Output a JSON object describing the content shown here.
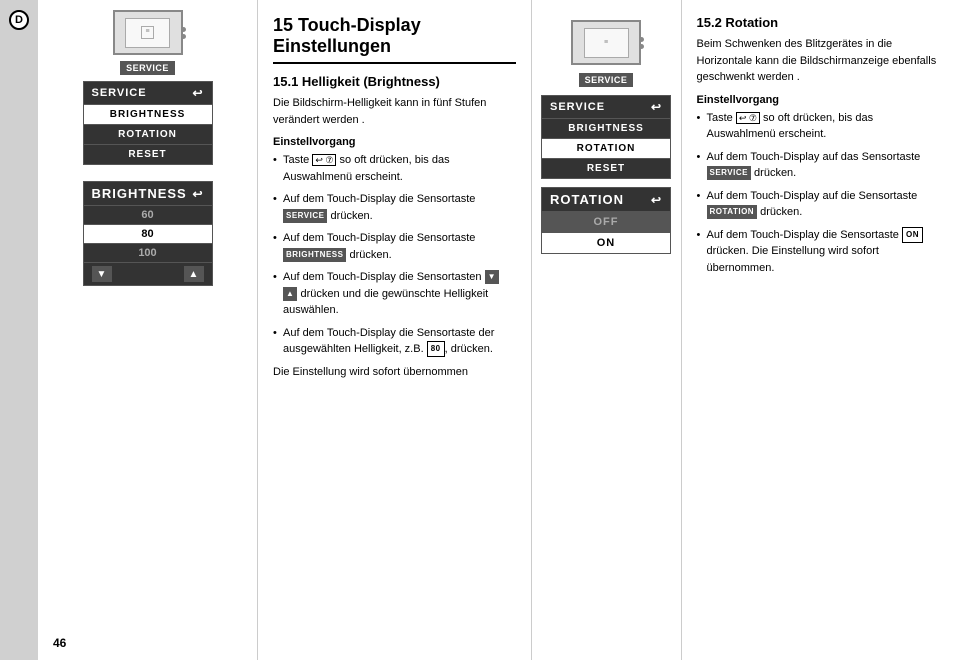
{
  "page": {
    "page_number": "46",
    "sidebar_letter": "D"
  },
  "left_section": {
    "title": "15 Touch-Display Einstellungen",
    "subsection_title": "15.1 Helligkeit (Brightness)",
    "intro_text": "Die Bildschirm-Helligkeit kann in fünf Stufen verändert werden .",
    "einstellvorgang_label": "Einstellvorgang",
    "bullets": [
      {
        "text_before": "Taste ",
        "badge": "↩ ⑦",
        "text_after": " so oft drücken, bis das Auswahlmenü erscheint."
      },
      {
        "text": "Auf dem Touch-Display die Sensortaste",
        "badge": "SERVICE",
        "text_after": " drücken."
      },
      {
        "text": "Auf dem Touch-Display die Sensortaste",
        "badge": "BRIGHTNESS",
        "text_after": " drücken."
      },
      {
        "text": "Auf dem Touch-Display die Sensortasten",
        "badge_down": "▼",
        "badge_up": "▲",
        "text_after": " drücken und die gewünschte Helligkeit auswählen."
      },
      {
        "text": "Auf dem Touch-Display die Sensortaste der ausgewählten Helligkeit, z.B.",
        "badge": "80",
        "text_after": ", drücken."
      }
    ],
    "footer_text": "Die Einstellung wird sofort übernommen"
  },
  "left_ui": {
    "service_button_label": "SERVICE",
    "menu_header": "SERVICE",
    "menu_items": [
      "BRIGHTNESS",
      "ROTATION",
      "RESET"
    ],
    "menu_highlighted": "BRIGHTNESS",
    "brightness_header": "BRIGHTNESS",
    "brightness_values": [
      "60",
      "80",
      "100"
    ],
    "brightness_selected": "80"
  },
  "right_section": {
    "title": "15.2 Rotation",
    "intro_text": "Beim Schwenken des Blitzgerätes in die Horizontale kann die Bildschirmanzeige ebenfalls geschwenkt werden .",
    "einstellvorgang_label": "Einstellvorgang",
    "bullets": [
      {
        "text_before": "Taste ",
        "badge": "↩ ⑦",
        "text_after": " so oft drücken, bis das Auswahlmenü erscheint."
      },
      {
        "text": "Auf dem Touch-Display auf das Sensortaste",
        "badge": "SERVICE",
        "text_after": " drücken."
      },
      {
        "text": "Auf dem Touch-Display auf die Sensortaste",
        "badge": "ROTATION",
        "text_after": " drücken."
      },
      {
        "text": "Auf dem Touch-Display die Sensortaste",
        "badge": "ON",
        "text_after": " drücken. Die Einstellung wird sofort übernommen."
      }
    ]
  },
  "right_ui": {
    "service_button_label": "SERVICE",
    "menu_header": "SERVICE",
    "menu_items": [
      "BRIGHTNESS",
      "ROTATION",
      "RESET"
    ],
    "menu_highlighted": "ROTATION",
    "rotation_header": "ROTATION",
    "rotation_items": [
      "OFF",
      "ON"
    ],
    "rotation_selected": "ON"
  }
}
